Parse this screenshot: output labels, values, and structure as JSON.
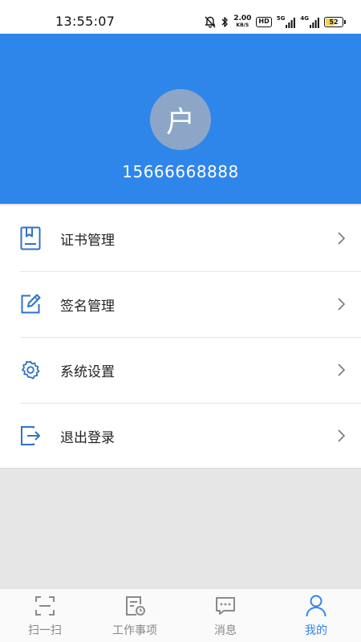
{
  "status_bar": {
    "time": "13:55:07",
    "speed_value": "2.00",
    "speed_unit": "KB/S",
    "hd_badge": "HD",
    "net1_label": "5G",
    "net2_label": "4G",
    "battery_level": "52",
    "battery_fraction": 0.52
  },
  "profile": {
    "avatar_text": "户",
    "phone": "15666668888"
  },
  "menu": {
    "items": [
      {
        "label": "证书管理",
        "icon": "certificate-icon"
      },
      {
        "label": "签名管理",
        "icon": "signature-edit-icon"
      },
      {
        "label": "系统设置",
        "icon": "gear-icon"
      },
      {
        "label": "退出登录",
        "icon": "logout-icon"
      }
    ]
  },
  "bottom_nav": {
    "items": [
      {
        "label": "扫一扫",
        "icon": "scan-icon"
      },
      {
        "label": "工作事项",
        "icon": "task-clock-icon"
      },
      {
        "label": "消息",
        "icon": "message-icon"
      },
      {
        "label": "我的",
        "icon": "user-icon",
        "active": true
      }
    ]
  },
  "colors": {
    "primary": "#2f86ea",
    "avatar_bg": "#8da6c8",
    "icon_blue": "#2f72c4",
    "nav_gray": "#888888",
    "background": "#e6e6e6"
  }
}
